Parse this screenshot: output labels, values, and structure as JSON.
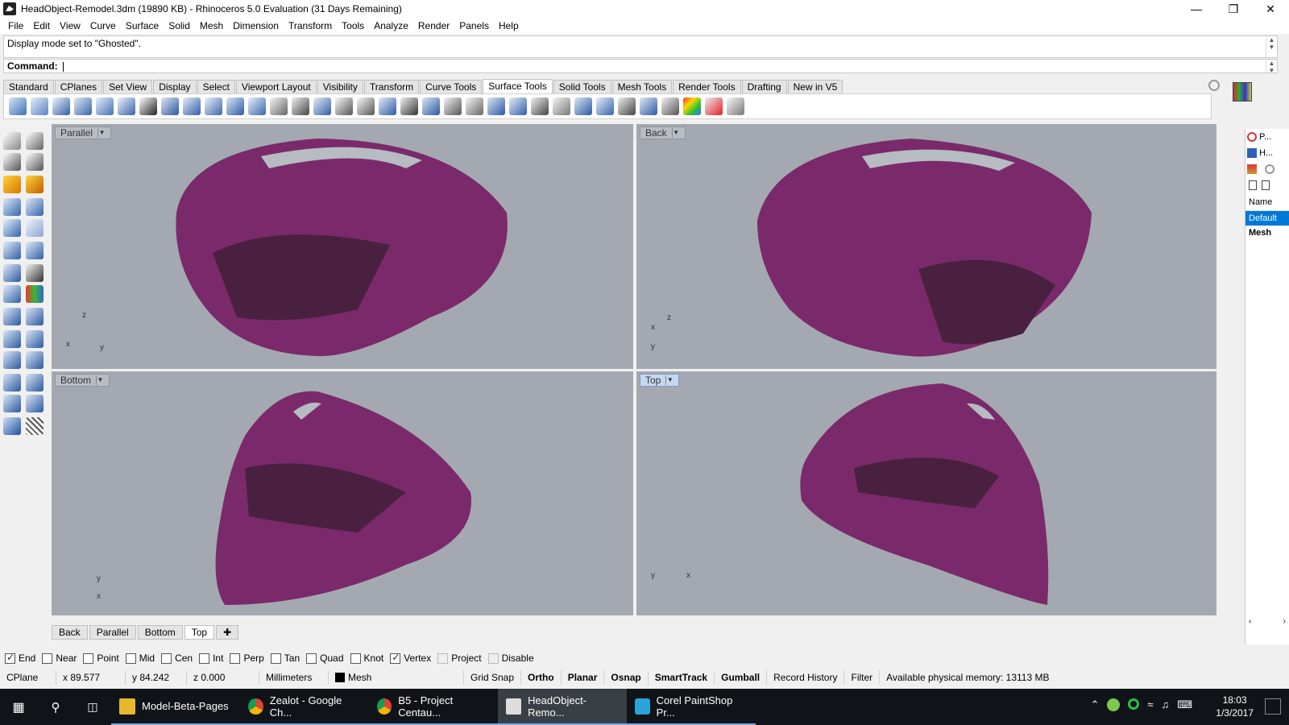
{
  "window": {
    "title": "HeadObject-Remodel.3dm (19890 KB) - Rhinoceros 5.0 Evaluation (31 Days Remaining)"
  },
  "menu": [
    "File",
    "Edit",
    "View",
    "Curve",
    "Surface",
    "Solid",
    "Mesh",
    "Dimension",
    "Transform",
    "Tools",
    "Analyze",
    "Render",
    "Panels",
    "Help"
  ],
  "command": {
    "history": "Display mode set to \"Ghosted\".",
    "prompt": "Command:"
  },
  "toolbar_tabs": [
    "Standard",
    "CPlanes",
    "Set View",
    "Display",
    "Select",
    "Viewport Layout",
    "Visibility",
    "Transform",
    "Curve Tools",
    "Surface Tools",
    "Solid Tools",
    "Mesh Tools",
    "Render Tools",
    "Drafting",
    "New in V5"
  ],
  "active_tab": "Surface Tools",
  "viewports": [
    {
      "label": "Parallel",
      "axes": [
        "z",
        "x",
        "y"
      ]
    },
    {
      "label": "Back",
      "axes": [
        "z",
        "x",
        "y"
      ]
    },
    {
      "label": "Bottom",
      "axes": [
        "y",
        "x"
      ]
    },
    {
      "label": "Top",
      "axes": [
        "y",
        "x"
      ]
    }
  ],
  "viewport_tabs": [
    "Back",
    "Parallel",
    "Bottom",
    "Top"
  ],
  "active_viewport_tab": "Top",
  "osnaps": [
    {
      "label": "End",
      "checked": true
    },
    {
      "label": "Near",
      "checked": false
    },
    {
      "label": "Point",
      "checked": false
    },
    {
      "label": "Mid",
      "checked": false
    },
    {
      "label": "Cen",
      "checked": false
    },
    {
      "label": "Int",
      "checked": false
    },
    {
      "label": "Perp",
      "checked": false
    },
    {
      "label": "Tan",
      "checked": false
    },
    {
      "label": "Quad",
      "checked": false
    },
    {
      "label": "Knot",
      "checked": false
    },
    {
      "label": "Vertex",
      "checked": true
    },
    {
      "label": "Project",
      "checked": false,
      "disabled": true
    },
    {
      "label": "Disable",
      "checked": false,
      "disabled": true
    }
  ],
  "status": {
    "cplane": "CPlane",
    "x": "x 89.577",
    "y": "y 84.242",
    "z": "z 0.000",
    "units": "Millimeters",
    "layer": "Mesh",
    "toggles": [
      "Grid Snap",
      "Ortho",
      "Planar",
      "Osnap",
      "SmartTrack",
      "Gumball",
      "Record History",
      "Filter"
    ],
    "bold_toggles": [
      "Ortho",
      "Planar",
      "Osnap",
      "SmartTrack",
      "Gumball"
    ],
    "memory": "Available physical memory: 13113 MB"
  },
  "right_panel": {
    "tab1": "P...",
    "tab2": "H...",
    "column": "Name",
    "layers": [
      "Default",
      "Mesh"
    ]
  },
  "taskbar": {
    "apps": [
      "Model-Beta-Pages",
      "Zealot - Google Ch...",
      "B5 - Project Centau...",
      "HeadObject-Remo...",
      "Corel PaintShop Pr..."
    ],
    "active_app": "HeadObject-Remo...",
    "time": "18:03",
    "date": "1/3/2017"
  },
  "colors": {
    "mesh": "#7a2a6a",
    "viewport_bg": "#a4a9b1",
    "accent": "#0078d7"
  }
}
